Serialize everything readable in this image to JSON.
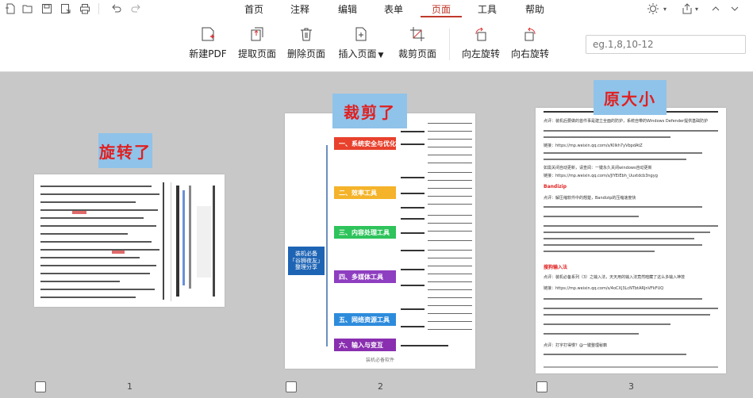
{
  "quick_access": [
    "new-icon",
    "open-icon",
    "save-icon",
    "save-as-icon",
    "print-icon",
    "undo-icon",
    "redo-icon"
  ],
  "menu": [
    "首页",
    "注释",
    "编辑",
    "表单",
    "页面",
    "工具",
    "帮助"
  ],
  "active_menu": "页面",
  "toolbar": [
    {
      "label": "新建PDF",
      "icon": "new-pdf-icon"
    },
    {
      "label": "提取页面",
      "icon": "extract-pages-icon"
    },
    {
      "label": "删除页面",
      "icon": "delete-pages-icon"
    },
    {
      "label": "插入页面",
      "icon": "insert-page-icon"
    },
    {
      "label": "裁剪页面",
      "icon": "crop-page-icon"
    },
    {
      "label": "向左旋转",
      "icon": "rotate-left-icon"
    },
    {
      "label": "向右旋转",
      "icon": "rotate-right-icon"
    }
  ],
  "range_input": {
    "placeholder": "eg.1,8,10-12"
  },
  "pages": [
    {
      "number": "1",
      "badge": "旋转了"
    },
    {
      "number": "2",
      "badge": "裁剪了"
    },
    {
      "number": "3",
      "badge": "原大小"
    }
  ],
  "page2": {
    "center_label": "装机必备\n「谷狮夜友」\n整理分享",
    "branches": [
      "一、系统安全与优化",
      "二、效率工具",
      "三、内容处理工具",
      "四、多媒体工具",
      "五、网络资源工具",
      "六、输入与变互"
    ],
    "footer": "装机必备软件"
  },
  "page3": {
    "section1": "Bandizip",
    "section2": "搜狗输入法",
    "lines": [
      "点评：装机后要做的首件事是建立全面的防护，系统自带的Windows Defender提供基础防护",
      "链接：https://mp.weixin.qq.com/s/Kllkh7yVbpdAtZ",
      "如需关闭自动更新，请查阅：一键永久关闭windows自动更新",
      "链接：https://mp.weixin.qq.com/s/JIYEiEbh_Uuxtdcb3ngyg",
      "点评：解压缩软件中的翘楚，Bandizip的压缩速度快",
      "点评：装机必备系列（3）之输入法，天天用的输入法竟然暗藏了这么多输入神技",
      "链接：https://mp.weixin.qq.com/s/4oCXj3LcNTbtARJnVFkFUQ",
      "点评：打字打得慢？@一键整理秘籍"
    ]
  }
}
